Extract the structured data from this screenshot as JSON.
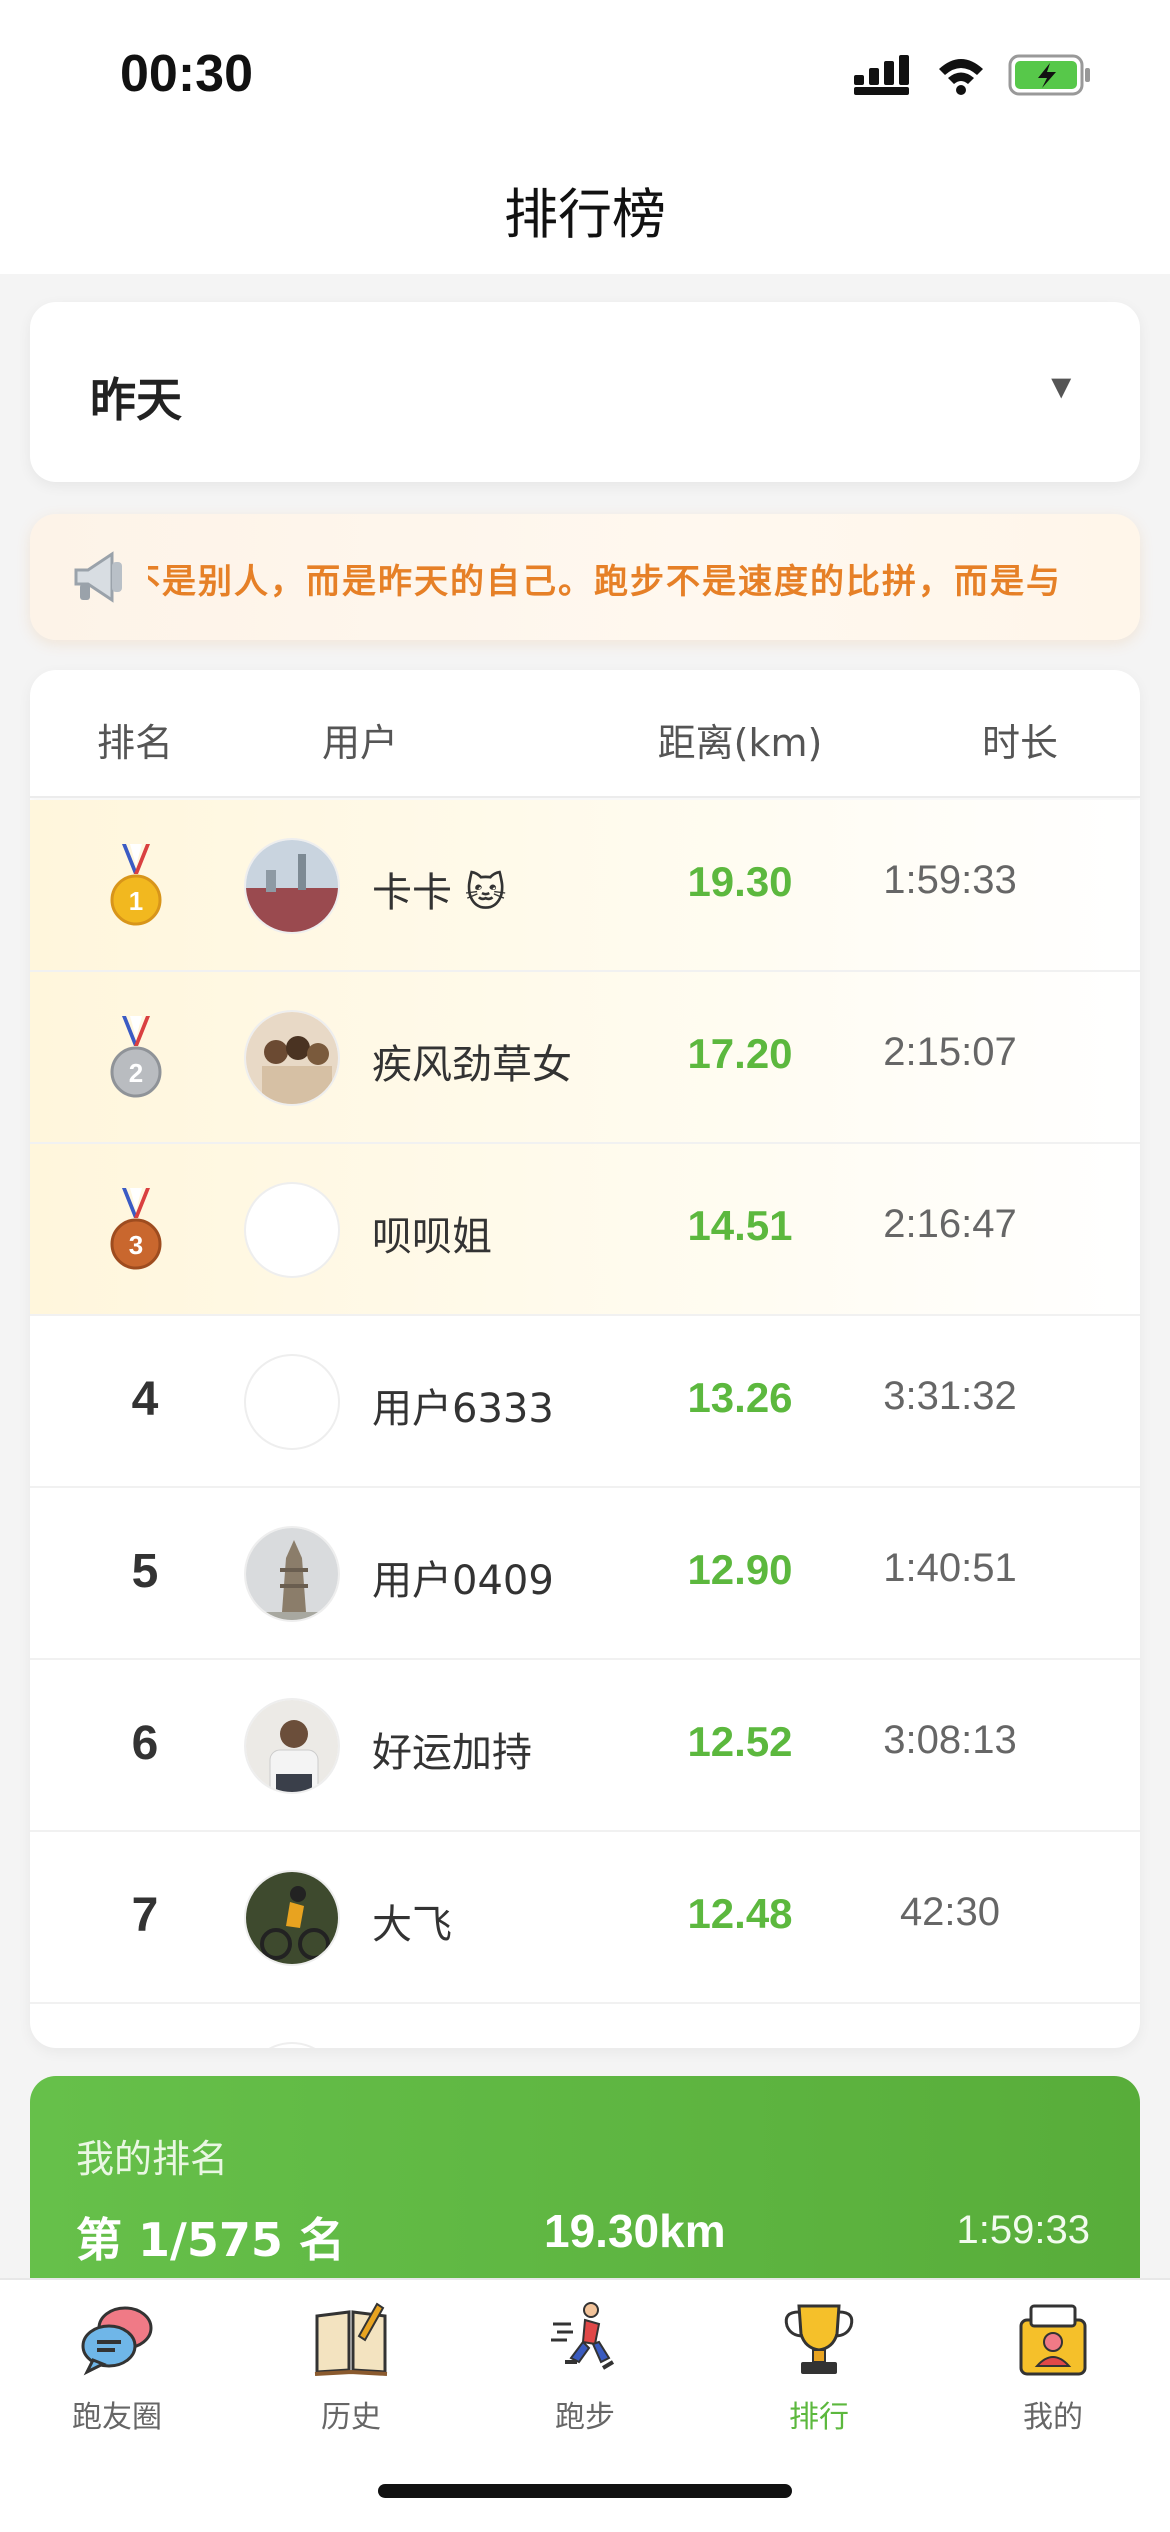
{
  "status_bar": {
    "time": "00:30"
  },
  "nav": {
    "title": "排行榜"
  },
  "period_select": {
    "value": "昨天",
    "arrow": "▼"
  },
  "notice": {
    "text": "不是别人，而是昨天的自己。跑步不是速度的比拼，而是与"
  },
  "table": {
    "headers": {
      "rank": "排名",
      "user": "用户",
      "distance": "距离(km)",
      "duration": "时长"
    },
    "rows": [
      {
        "rank": "1",
        "medal": "gold",
        "name": "卡卡 🐱",
        "distance": "19.30",
        "duration": "1:59:33"
      },
      {
        "rank": "2",
        "medal": "silver",
        "name": "疾风劲草女",
        "distance": "17.20",
        "duration": "2:15:07"
      },
      {
        "rank": "3",
        "medal": "bronze",
        "name": "呗呗姐",
        "distance": "14.51",
        "duration": "2:16:47"
      },
      {
        "rank": "4",
        "name": "用户6333",
        "distance": "13.26",
        "duration": "3:31:32"
      },
      {
        "rank": "5",
        "name": "用户0409",
        "distance": "12.90",
        "duration": "1:40:51"
      },
      {
        "rank": "6",
        "name": "好运加持",
        "distance": "12.52",
        "duration": "3:08:13"
      },
      {
        "rank": "7",
        "name": "大飞",
        "distance": "12.48",
        "duration": "42:30"
      }
    ]
  },
  "my_rank": {
    "label": "我的排名",
    "rank": "第 1/575 名",
    "distance": "19.30km",
    "duration": "1:59:33"
  },
  "tabs": [
    {
      "label": "跑友圈",
      "icon": "chat-bubbles-icon"
    },
    {
      "label": "历史",
      "icon": "book-icon"
    },
    {
      "label": "跑步",
      "icon": "runner-icon"
    },
    {
      "label": "排行",
      "icon": "trophy-icon",
      "active": true
    },
    {
      "label": "我的",
      "icon": "profile-card-icon"
    }
  ],
  "colors": {
    "accent": "#5cb83e",
    "notice": "#e68027"
  }
}
